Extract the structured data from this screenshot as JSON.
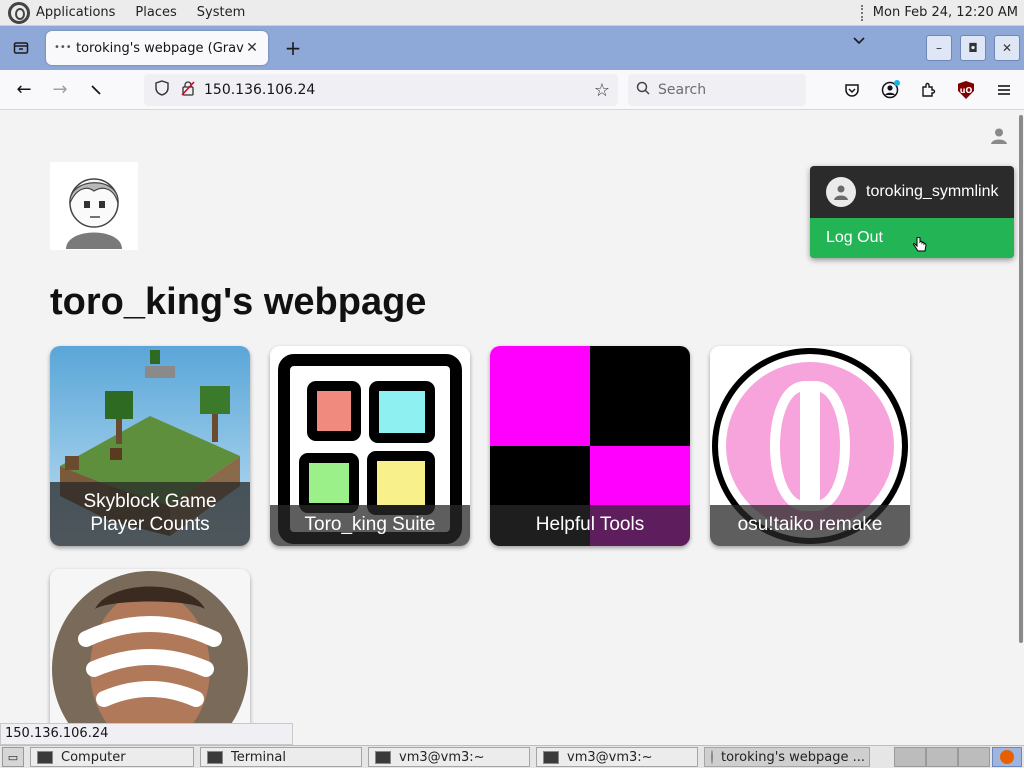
{
  "top_panel": {
    "menus": [
      "Applications",
      "Places",
      "System"
    ],
    "clock": "Mon Feb 24, 12:20 AM"
  },
  "browser": {
    "tab_title": "toroking's webpage (Gravity",
    "url": "150.136.106.24",
    "search_placeholder": "Search"
  },
  "page": {
    "title": "toro_king's webpage",
    "cards": [
      {
        "label": "Skyblock Game Player Counts"
      },
      {
        "label": "Toro_king Suite"
      },
      {
        "label": "Helpful Tools"
      },
      {
        "label": "osu!taiko remake"
      }
    ],
    "dropdown": {
      "username": "toroking_symmlink",
      "logout": "Log Out"
    },
    "colors": {
      "logout_green": "#22b455",
      "magenta": "#ff00ff",
      "dropdown_bg": "#2b2b2b"
    }
  },
  "status_bar": "150.136.106.24",
  "taskbar": {
    "tasks": [
      "Computer",
      "Terminal",
      "vm3@vm3:~",
      "vm3@vm3:~",
      "toroking's webpage ..."
    ]
  }
}
